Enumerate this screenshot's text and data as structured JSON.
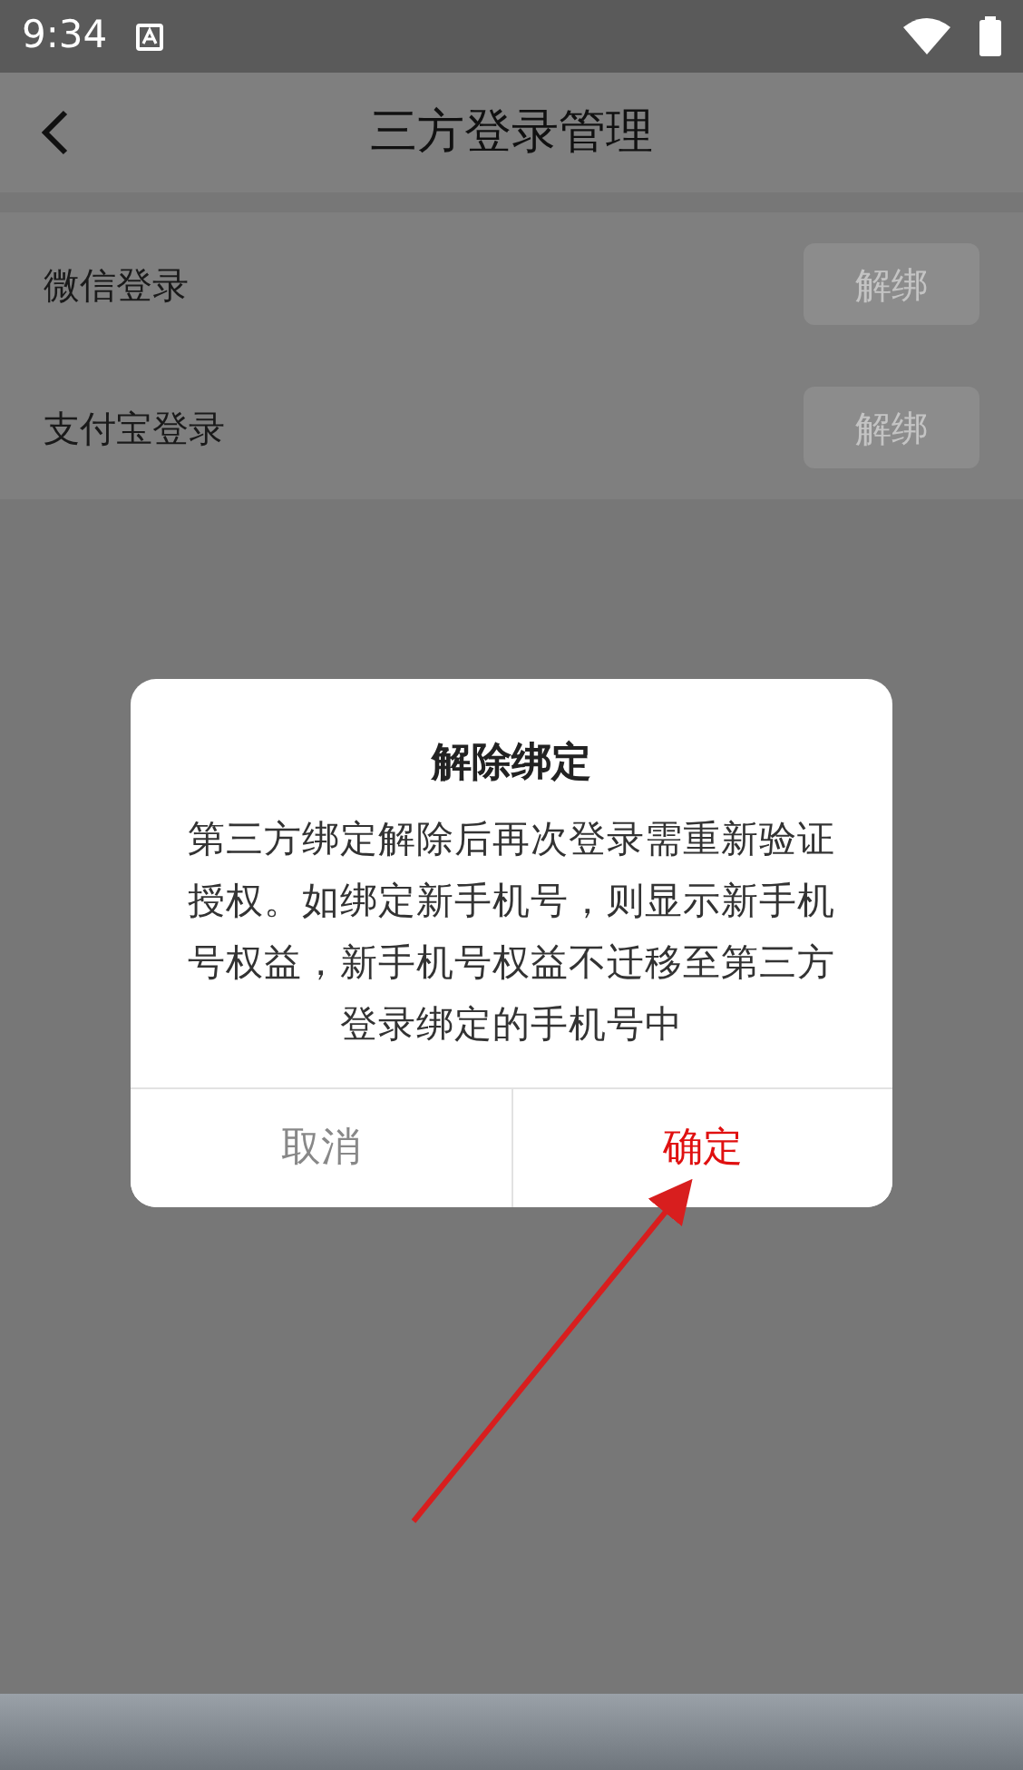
{
  "status_bar": {
    "time": "9:34"
  },
  "header": {
    "title": "三方登录管理"
  },
  "bindings": [
    {
      "label": "微信登录",
      "button": "解绑"
    },
    {
      "label": "支付宝登录",
      "button": "解绑"
    }
  ],
  "dialog": {
    "title": "解除绑定",
    "message": "第三方绑定解除后再次登录需重新验证授权。如绑定新手机号，则显示新手机号权益，新手机号权益不迁移至第三方登录绑定的手机号中",
    "buttons": [
      {
        "label": "取消",
        "kind": "cancel"
      },
      {
        "label": "确定",
        "kind": "confirm"
      }
    ]
  }
}
